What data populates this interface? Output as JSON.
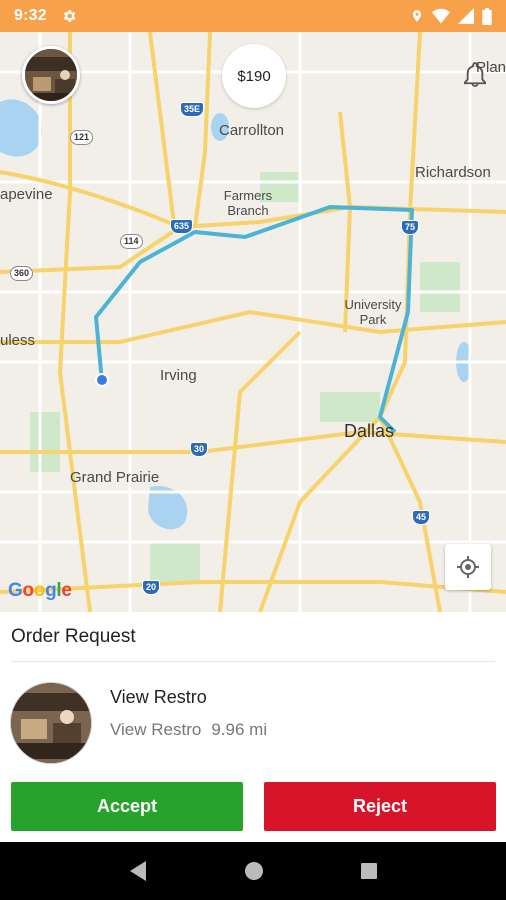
{
  "status_bar": {
    "time": "9:32",
    "icons": [
      "gear-icon",
      "location-icon",
      "wifi-icon",
      "signal-icon",
      "battery-icon"
    ]
  },
  "map": {
    "price": "$190",
    "bell_label": "Plan",
    "labels": {
      "carrollton": "Carrollton",
      "richardson": "Richardson",
      "grapevine": "apevine",
      "farmers_branch": "Farmers Branch",
      "university_park": "University Park",
      "euless": "uless",
      "irving": "Irving",
      "dallas": "Dallas",
      "grand_prairie": "Grand Prairie"
    },
    "shields": {
      "i35e": "35E",
      "i635": "635",
      "i75": "75",
      "i30": "30",
      "i45": "45",
      "i20": "20",
      "r121": "121",
      "r114": "114",
      "r360": "360"
    },
    "google": "Google",
    "route_color": "#4db3d6",
    "icons": [
      "bell-icon",
      "my-location-icon"
    ]
  },
  "order": {
    "title": "Order Request",
    "restaurant_name": "View Restro",
    "restaurant_sub": "View Restro",
    "distance": "9.96 mi",
    "accept_label": "Accept",
    "reject_label": "Reject",
    "accept_color": "#25a32a",
    "reject_color": "#d8142b"
  },
  "nav_bar": {
    "icons": [
      "back-icon",
      "home-icon",
      "recents-icon"
    ]
  }
}
